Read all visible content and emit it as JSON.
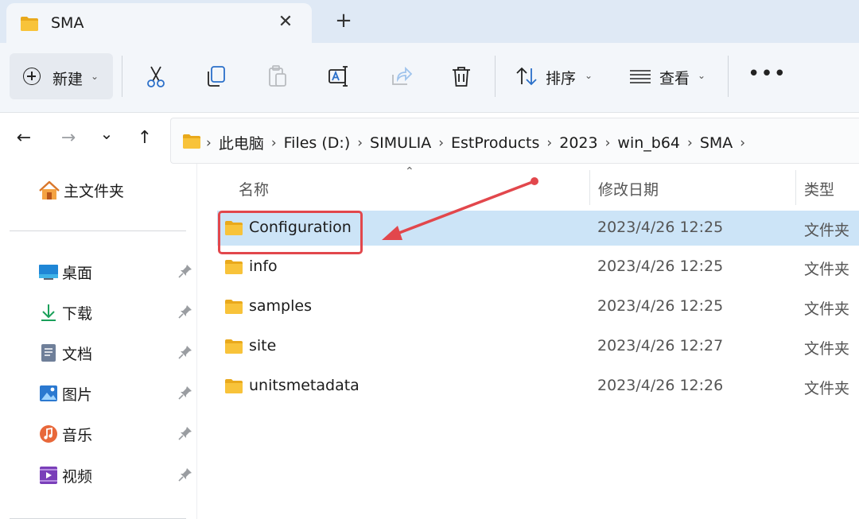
{
  "tab": {
    "title": "SMA",
    "close": "✕",
    "new_tab": "+"
  },
  "toolbar": {
    "new_label": "新建",
    "sort_label": "排序",
    "view_label": "查看",
    "more": "•••"
  },
  "nav": {
    "back": "←",
    "forward": "→",
    "recent": "⌄",
    "up": "↑"
  },
  "breadcrumb": [
    "此电脑",
    "Files (D:)",
    "SIMULIA",
    "EstProducts",
    "2023",
    "win_b64",
    "SMA"
  ],
  "sidebar": {
    "home": "主文件夹",
    "items": [
      {
        "label": "桌面",
        "icon": "desktop-icon"
      },
      {
        "label": "下载",
        "icon": "download-icon"
      },
      {
        "label": "文档",
        "icon": "document-icon"
      },
      {
        "label": "图片",
        "icon": "pictures-icon"
      },
      {
        "label": "音乐",
        "icon": "music-icon"
      },
      {
        "label": "视频",
        "icon": "video-icon"
      }
    ]
  },
  "columns": {
    "name": "名称",
    "date": "修改日期",
    "type": "类型"
  },
  "files": [
    {
      "name": "Configuration",
      "date": "2023/4/26 12:25",
      "type": "文件夹"
    },
    {
      "name": "info",
      "date": "2023/4/26 12:25",
      "type": "文件夹"
    },
    {
      "name": "samples",
      "date": "2023/4/26 12:25",
      "type": "文件夹"
    },
    {
      "name": "site",
      "date": "2023/4/26 12:27",
      "type": "文件夹"
    },
    {
      "name": "unitsmetadata",
      "date": "2023/4/26 12:26",
      "type": "文件夹"
    }
  ],
  "colors": {
    "selection": "#cce4f7",
    "annotation": "#e2474c",
    "folder": "#f8c33a"
  }
}
